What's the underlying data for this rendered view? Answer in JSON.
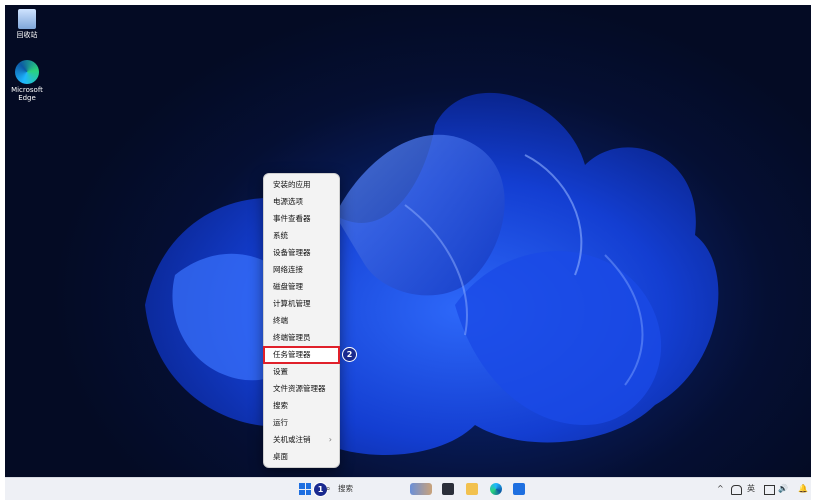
{
  "desktop_icons": [
    {
      "label": "回收站",
      "icon": "recycle-bin-icon"
    },
    {
      "label": "Microsoft Edge",
      "icon": "edge-icon"
    }
  ],
  "context_menu": {
    "items": [
      {
        "label": "安装的应用"
      },
      {
        "label": "电源选项"
      },
      {
        "label": "事件查看器"
      },
      {
        "label": "系统"
      },
      {
        "label": "设备管理器"
      },
      {
        "label": "网络连接"
      },
      {
        "label": "磁盘管理"
      },
      {
        "label": "计算机管理"
      },
      {
        "label": "终端"
      },
      {
        "label": "终端管理员"
      },
      {
        "label": "任务管理器",
        "highlighted": true
      },
      {
        "label": "设置"
      },
      {
        "label": "文件资源管理器"
      },
      {
        "label": "搜索"
      },
      {
        "label": "运行"
      },
      {
        "label": "关机或注销",
        "submenu": true
      },
      {
        "label": "桌面"
      }
    ],
    "submenu_chevron": "›"
  },
  "annotations": {
    "step1": "1",
    "step2": "2"
  },
  "taskbar": {
    "search_label": "搜索",
    "search_icon": "search-icon",
    "apps": [
      "widgets-icon",
      "task-view-icon",
      "file-explorer-icon",
      "edge-icon",
      "store-icon"
    ],
    "tray": {
      "chevron": "^",
      "ime": "英",
      "volume": "🔊",
      "bell": "🔔"
    }
  },
  "colors": {
    "highlight_border": "#e0202a",
    "badge_fill": "#1a2a8f",
    "accent": "#1e6fe0"
  }
}
